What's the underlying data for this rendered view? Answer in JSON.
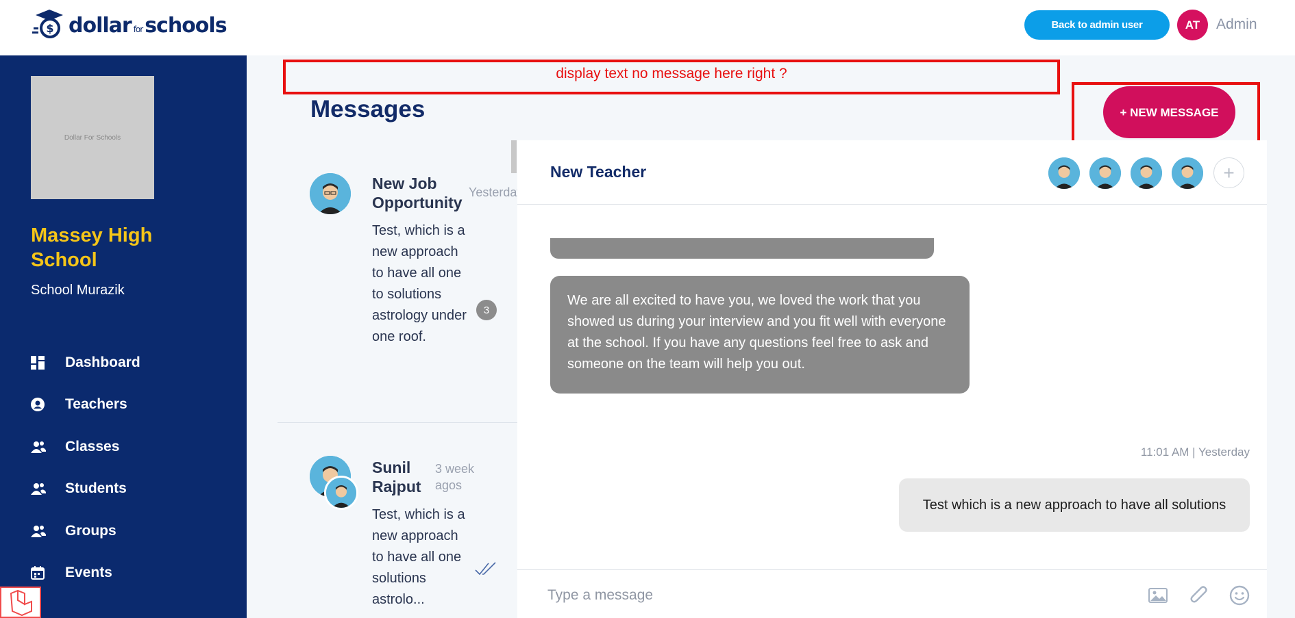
{
  "header": {
    "logo": {
      "part1": "dollar",
      "part2": "for",
      "part3": "schools"
    },
    "back_button": "Back to admin user",
    "avatar_initials": "AT",
    "user_label": "Admin"
  },
  "sidebar": {
    "image_placeholder": "Dollar For Schools",
    "school_name": "Massey High School",
    "school_sub": "School Murazik",
    "nav": [
      {
        "label": "Dashboard",
        "icon": "dashboard-icon"
      },
      {
        "label": "Teachers",
        "icon": "person-circle-icon"
      },
      {
        "label": "Classes",
        "icon": "people-icon"
      },
      {
        "label": "Students",
        "icon": "people-icon"
      },
      {
        "label": "Groups",
        "icon": "people-icon"
      },
      {
        "label": "Events",
        "icon": "calendar-icon"
      }
    ]
  },
  "annotation": {
    "text": "display text no message here right ?"
  },
  "main": {
    "title": "Messages",
    "new_message_button": "+ NEW MESSAGE"
  },
  "threads": [
    {
      "title": "New Job Opportunity",
      "time": "Yesterday",
      "preview": "Test, which is a new approach to have all one to solutions astrology under one roof.",
      "unread": "3"
    },
    {
      "title": "Sunil Rajput",
      "time": "3 week agos",
      "preview": "Test, which is a new approach to have all one solutions astrolo..."
    }
  ],
  "conversation": {
    "title": "New Teacher",
    "participants_count": 4,
    "incoming": "We are all excited to have you, we loved the work that you showed us during your interview and you fit well with everyone at the school. If you have any questions feel free to ask and someone on the team will help you out.",
    "timestamp": "11:01 AM | Yesterday",
    "outgoing": "Test which is a new approach to have all solutions",
    "composer_placeholder": "Type a message"
  },
  "colors": {
    "sidebar": "#0b2a6e",
    "accent_pink": "#d10f5c",
    "accent_blue": "#0c9ee8",
    "school_name": "#f5c518",
    "annotation_red": "#e81010"
  }
}
